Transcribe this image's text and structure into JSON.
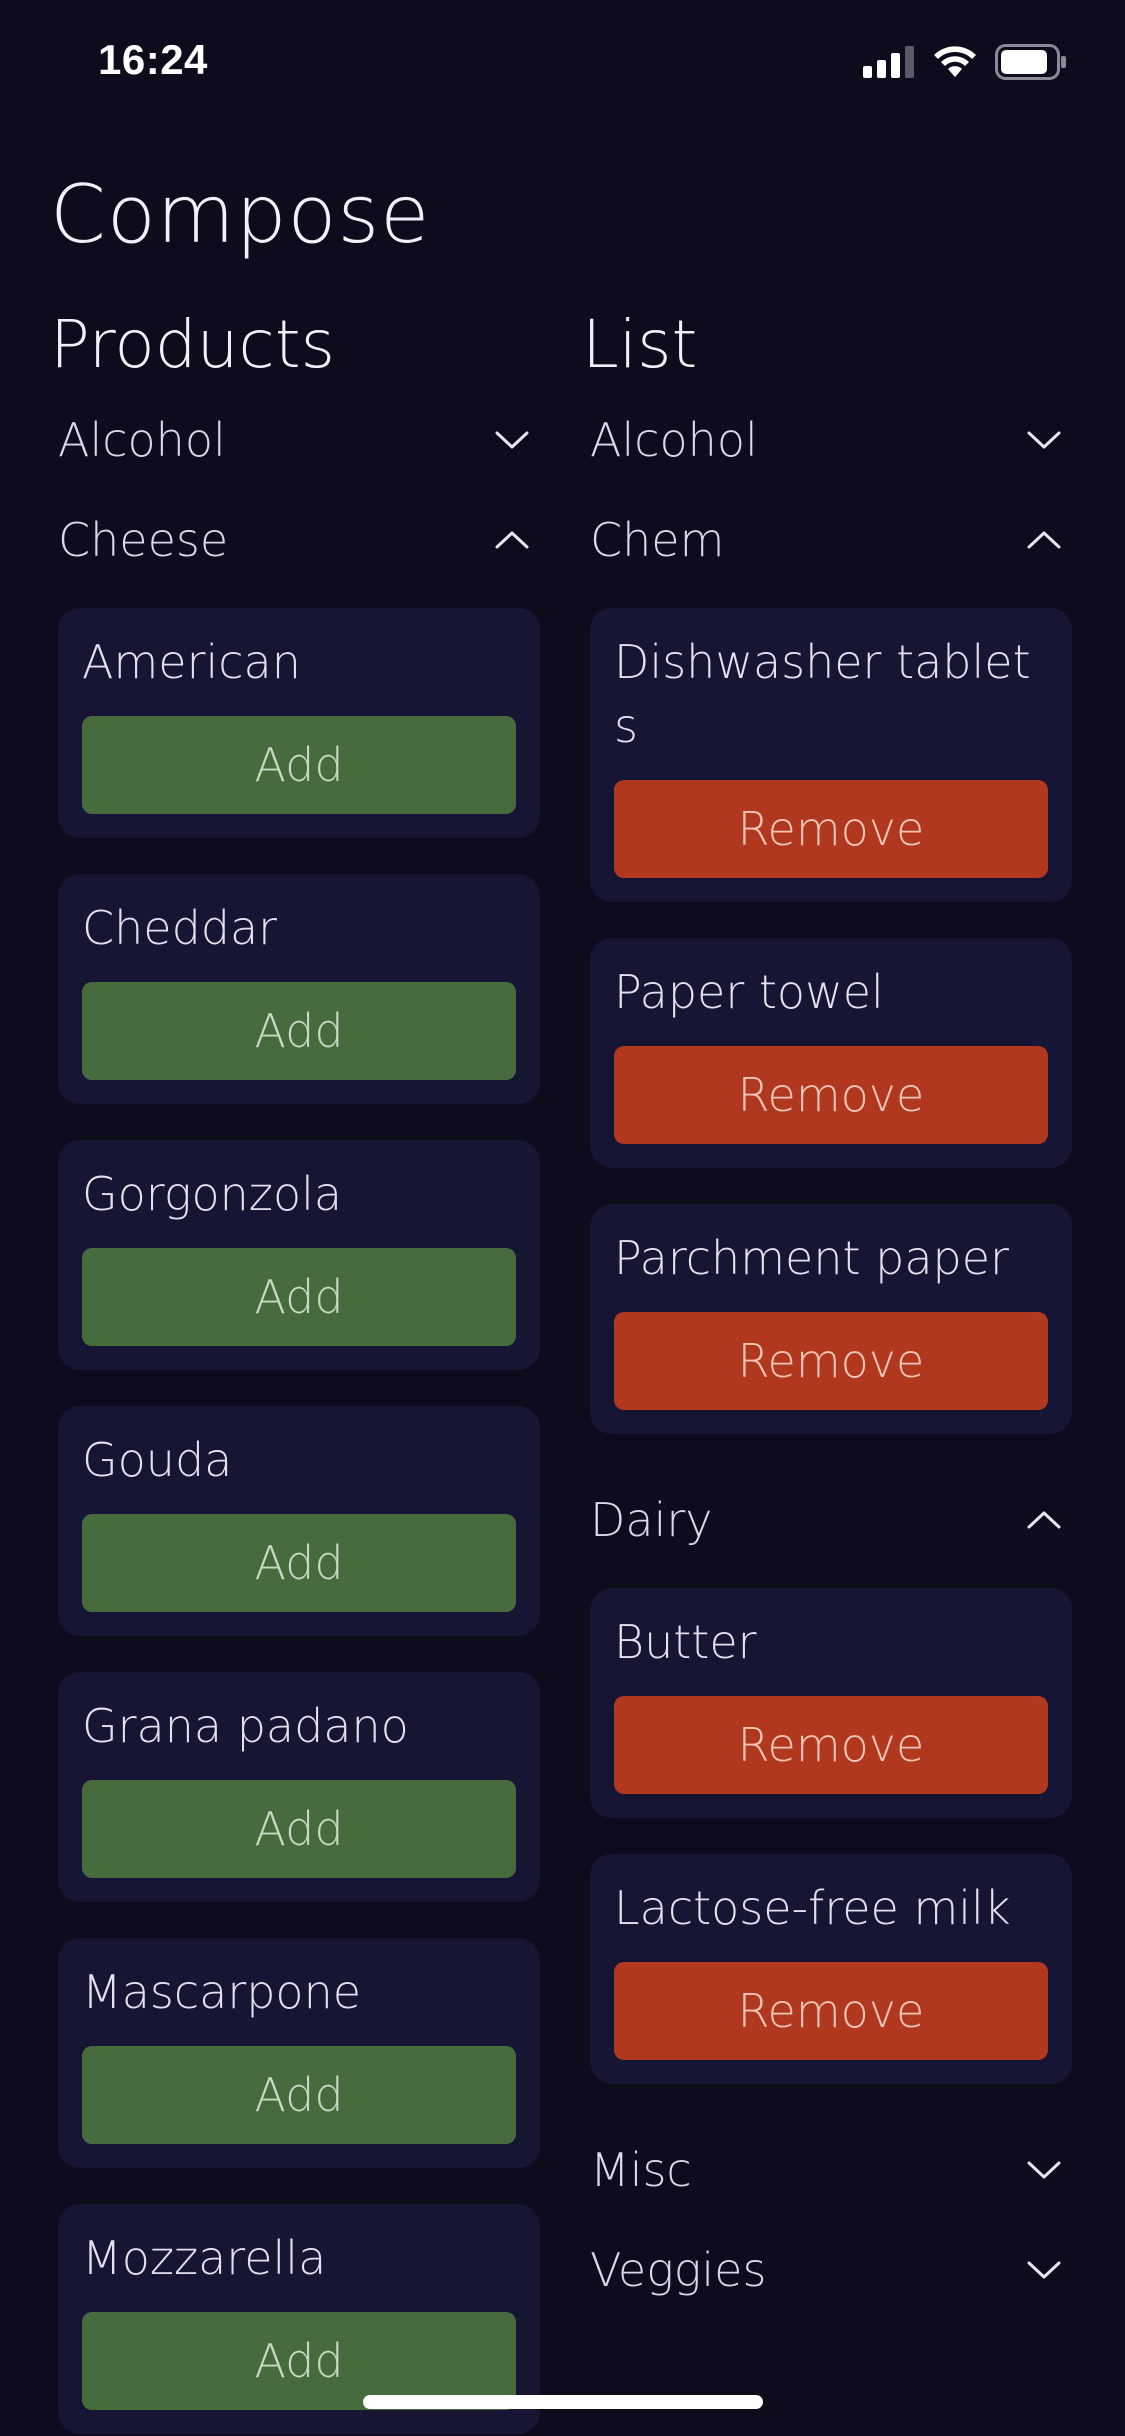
{
  "status_bar": {
    "time": "16:24"
  },
  "page_title": "Compose",
  "products": {
    "title": "Products",
    "categories": [
      {
        "label": "Alcohol",
        "expanded": false
      },
      {
        "label": "Cheese",
        "expanded": true
      }
    ],
    "items": [
      {
        "name": "American",
        "action": "Add"
      },
      {
        "name": "Cheddar",
        "action": "Add"
      },
      {
        "name": "Gorgonzola",
        "action": "Add"
      },
      {
        "name": "Gouda",
        "action": "Add"
      },
      {
        "name": "Grana padano",
        "action": "Add"
      },
      {
        "name": "Mascarpone",
        "action": "Add"
      },
      {
        "name": "Mozzarella",
        "action": "Add"
      }
    ]
  },
  "list": {
    "title": "List",
    "categories": [
      {
        "label": "Alcohol",
        "expanded": false
      },
      {
        "label": "Chem",
        "expanded": true,
        "items": [
          {
            "name": "Dishwasher tablets",
            "action": "Remove"
          },
          {
            "name": "Paper towel",
            "action": "Remove"
          },
          {
            "name": "Parchment paper",
            "action": "Remove"
          }
        ]
      },
      {
        "label": "Dairy",
        "expanded": true,
        "items": [
          {
            "name": "Butter",
            "action": "Remove"
          },
          {
            "name": "Lactose-free milk",
            "action": "Remove"
          }
        ]
      },
      {
        "label": "Misc",
        "expanded": false
      },
      {
        "label": "Veggies",
        "expanded": false
      }
    ]
  },
  "colors": {
    "background": "#0c0c1c",
    "card": "#161634",
    "add": "#476b3d",
    "remove": "#b0381e"
  }
}
